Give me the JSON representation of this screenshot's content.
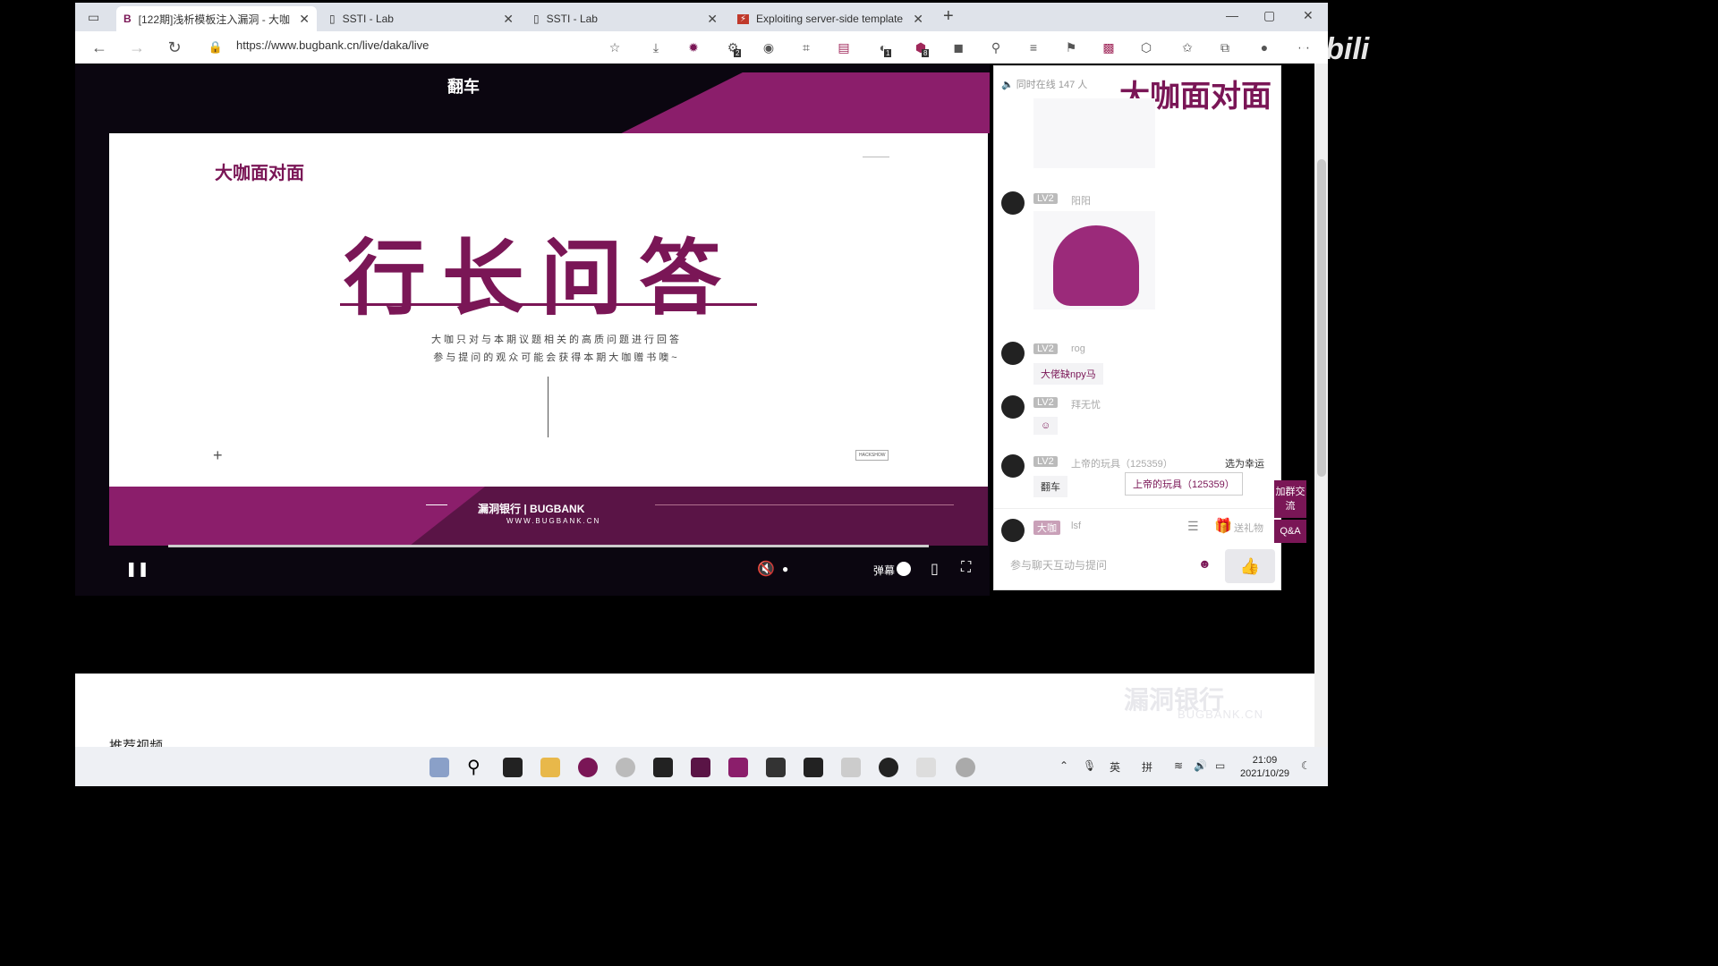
{
  "browser": {
    "tabs": [
      {
        "title": "[122期]浅析模板注入漏洞 - 大咖"
      },
      {
        "title": "SSTI - Lab"
      },
      {
        "title": "SSTI - Lab"
      },
      {
        "title": "Exploiting server-side template"
      }
    ],
    "url": "https://www.bugbank.cn/live/daka/live",
    "badges": {
      "ext2": "2",
      "ext1": "1",
      "ext8": "8"
    }
  },
  "player": {
    "title": "翻车",
    "slide": {
      "logo": "大咖面对面",
      "heading": "行长问答",
      "line1": "大咖只对与本期议题相关的高质问题进行回答",
      "line2": "参与提问的观众可能会获得本期大咖赠书噢~",
      "badge": "HACKSHOW"
    },
    "banner": {
      "logo": "漏洞银行 | BUGBANK",
      "sub": "WWW.BUGBANK.CN"
    },
    "danmaku_label": "弹幕"
  },
  "chat": {
    "online_label": "同时在线",
    "online_count": "147",
    "online_unit": "人",
    "logo": "大咖面对面",
    "messages": [
      {
        "level": "LV2",
        "name": "阳阳",
        "type": "sticker"
      },
      {
        "level": "LV2",
        "name": "rog",
        "text": "大佬缺npy马"
      },
      {
        "level": "LV2",
        "name": "拜无忧",
        "type": "emoji"
      },
      {
        "level": "LV2",
        "name": "上帝的玩具（125359）",
        "action": "选为幸运",
        "text": "翻车",
        "reply": "上帝的玩具（125359）"
      }
    ],
    "me": {
      "level": "大咖",
      "name": "lsf",
      "gift": "送礼物"
    },
    "input_placeholder": "参与聊天互动与提问",
    "side_tabs": {
      "group": "加群交流",
      "qa": "Q&A"
    }
  },
  "below": {
    "recommend": "推荐视频",
    "watermark": "漏洞银行",
    "watermark_sub": "BUGBANK.CN"
  },
  "taskbar": {
    "ime1": "英",
    "ime2": "拼",
    "time": "21:09",
    "date": "2021/10/29"
  },
  "overlay": {
    "bilibili": "bilibili"
  }
}
